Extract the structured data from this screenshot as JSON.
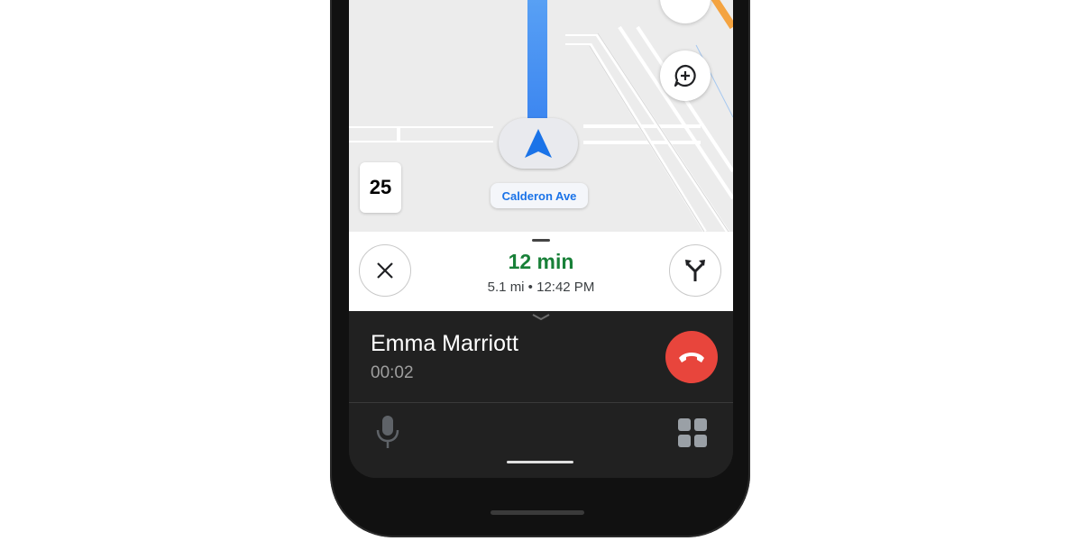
{
  "map": {
    "speed_limit": "25",
    "street_name": "Calderon Ave"
  },
  "trip": {
    "eta_duration": "12 min",
    "eta_details": "5.1 mi • 12:42 PM"
  },
  "call": {
    "caller_name": "Emma Marriott",
    "duration": "00:02"
  },
  "icons": {
    "close": "close-icon",
    "alt_routes": "alternate-routes-icon",
    "report": "add-report-icon",
    "nav_arrow": "navigation-arrow-icon",
    "end_call": "end-call-icon",
    "mic": "microphone-icon",
    "apps": "apps-grid-icon",
    "collapse": "chevron-down-icon"
  },
  "colors": {
    "route": "#3b85f0",
    "eta_green": "#188038",
    "street_label": "#1a73e8",
    "end_call_red": "#e8453c",
    "call_panel_bg": "#212121"
  }
}
